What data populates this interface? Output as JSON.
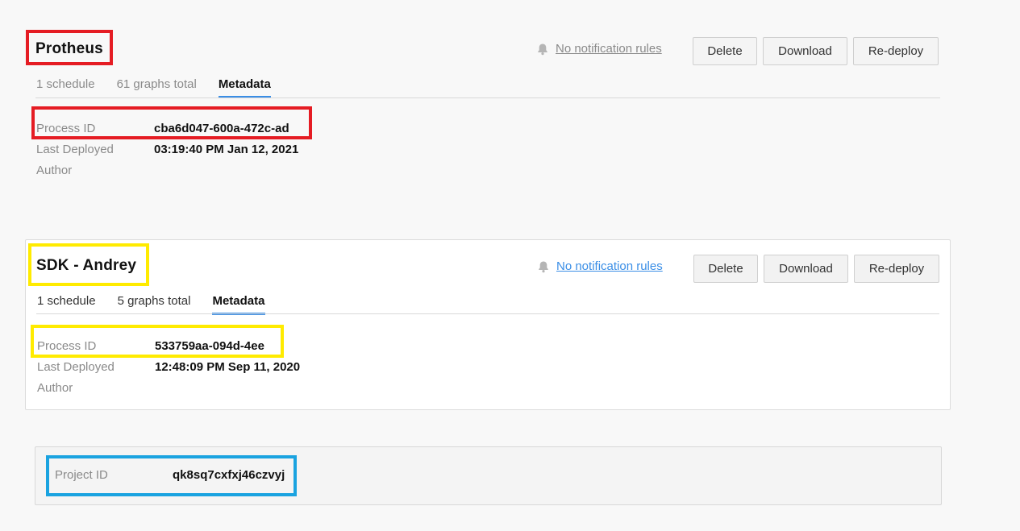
{
  "cards": [
    {
      "title": "Protheus",
      "notification_link": "No notification rules",
      "buttons": {
        "delete": "Delete",
        "download": "Download",
        "redeploy": "Re-deploy"
      },
      "tabs": [
        "1 schedule",
        "61 graphs total",
        "Metadata"
      ],
      "active_tab": "Metadata",
      "metadata": {
        "process_id_label": "Process ID",
        "process_id": "cba6d047-600a-472c-ad",
        "last_deployed_label": "Last Deployed",
        "last_deployed": "03:19:40 PM Jan 12, 2021",
        "author_label": "Author",
        "author": ""
      },
      "highlight_color": "#e51c23"
    },
    {
      "title": "SDK - Andrey",
      "notification_link": "No notification rules",
      "buttons": {
        "delete": "Delete",
        "download": "Download",
        "redeploy": "Re-deploy"
      },
      "tabs": [
        "1 schedule",
        "5 graphs total",
        "Metadata"
      ],
      "active_tab": "Metadata",
      "metadata": {
        "process_id_label": "Process ID",
        "process_id": "533759aa-094d-4ee",
        "last_deployed_label": "Last Deployed",
        "last_deployed": "12:48:09 PM Sep 11, 2020",
        "author_label": "Author",
        "author": ""
      },
      "highlight_color": "#ffeb00"
    }
  ],
  "project": {
    "label": "Project ID",
    "value": "qk8sq7cxfxj46czvyj",
    "highlight_color": "#1aa3e0"
  },
  "icons": {
    "notification": "bell-icon"
  },
  "colors": {
    "accent": "#3a8ee6",
    "muted_text": "#8a8a8a"
  }
}
